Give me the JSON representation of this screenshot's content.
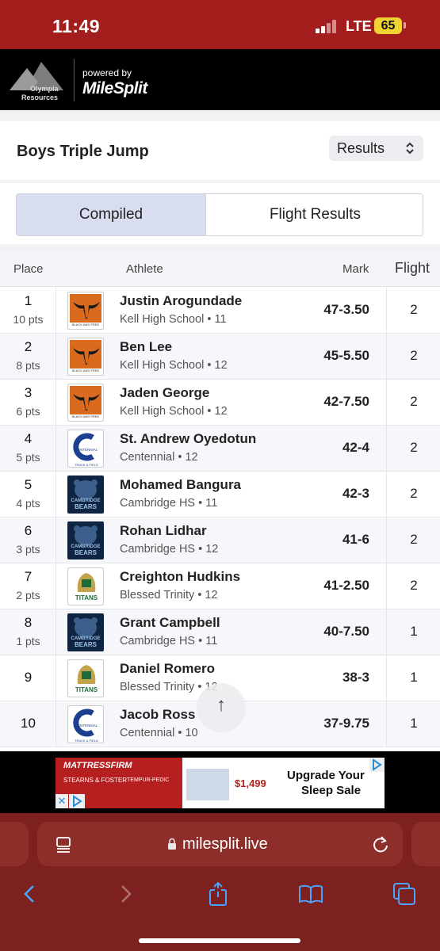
{
  "status_bar": {
    "time": "11:49",
    "network": "LTE",
    "battery": "65",
    "colors": {
      "background": "#a21d1b",
      "battery": "#f1d233"
    }
  },
  "brand": {
    "org_line1": "Olympia",
    "org_line2": "Resources",
    "powered_by": "powered by",
    "partner": "MileSplit"
  },
  "event": {
    "title": "Boys Triple Jump",
    "view_select": "Results"
  },
  "tabs": [
    {
      "label": "Compiled",
      "selected": true
    },
    {
      "label": "Flight Results",
      "selected": false
    }
  ],
  "table": {
    "headers": {
      "place": "Place",
      "athlete": "Athlete",
      "mark": "Mark",
      "flight": "Flight"
    },
    "rows": [
      {
        "place": "1",
        "points": "10 pts",
        "name": "Justin Arogundade",
        "school": "Kell High School • 11",
        "mark": "47-3.50",
        "flight": "2",
        "logo": "kell"
      },
      {
        "place": "2",
        "points": "8 pts",
        "name": "Ben Lee",
        "school": "Kell High School • 12",
        "mark": "45-5.50",
        "flight": "2",
        "logo": "kell"
      },
      {
        "place": "3",
        "points": "6 pts",
        "name": "Jaden George",
        "school": "Kell High School • 12",
        "mark": "42-7.50",
        "flight": "2",
        "logo": "kell"
      },
      {
        "place": "4",
        "points": "5 pts",
        "name": "St. Andrew Oyedotun",
        "school": "Centennial • 12",
        "mark": "42-4",
        "flight": "2",
        "logo": "centennial"
      },
      {
        "place": "5",
        "points": "4 pts",
        "name": "Mohamed Bangura",
        "school": "Cambridge HS • 11",
        "mark": "42-3",
        "flight": "2",
        "logo": "cambridge"
      },
      {
        "place": "6",
        "points": "3 pts",
        "name": "Rohan Lidhar",
        "school": "Cambridge HS • 12",
        "mark": "41-6",
        "flight": "2",
        "logo": "cambridge"
      },
      {
        "place": "7",
        "points": "2 pts",
        "name": "Creighton Hudkins",
        "school": "Blessed Trinity • 12",
        "mark": "41-2.50",
        "flight": "2",
        "logo": "titans"
      },
      {
        "place": "8",
        "points": "1 pts",
        "name": "Grant Campbell",
        "school": "Cambridge HS • 11",
        "mark": "40-7.50",
        "flight": "1",
        "logo": "cambridge"
      },
      {
        "place": "9",
        "points": "",
        "name": "Daniel Romero",
        "school": "Blessed Trinity • 12",
        "mark": "38-3",
        "flight": "1",
        "logo": "titans"
      },
      {
        "place": "10",
        "points": "",
        "name": "Jacob Ross",
        "school": "Centennial • 10",
        "mark": "37-9.75",
        "flight": "1",
        "logo": "centennial"
      }
    ]
  },
  "logo_text": {
    "kell": "BLACK AND FREE",
    "centennial_letter": "C",
    "centennial_word": "CENTENNIAL",
    "centennial_sub": "TRACK & FIELD",
    "cambridge_line1": "CAMBRIDGE",
    "cambridge_line2": "BEARS",
    "titans": "TITANS"
  },
  "scroll_top": {
    "icon": "arrow-up-icon",
    "glyph": "↑"
  },
  "ad": {
    "brand": "MATTRESSFIRM",
    "sub1": "STEARNS & FOSTER",
    "sub2": "TEMPUR-PEDIC",
    "price": "$1,499",
    "headline_line1": "Upgrade Your",
    "headline_line2": "Sleep Sale",
    "close": "✕"
  },
  "browser": {
    "url": "milesplit.live",
    "colors": {
      "chrome": "#7c2120",
      "field": "#8e2e2b"
    }
  }
}
